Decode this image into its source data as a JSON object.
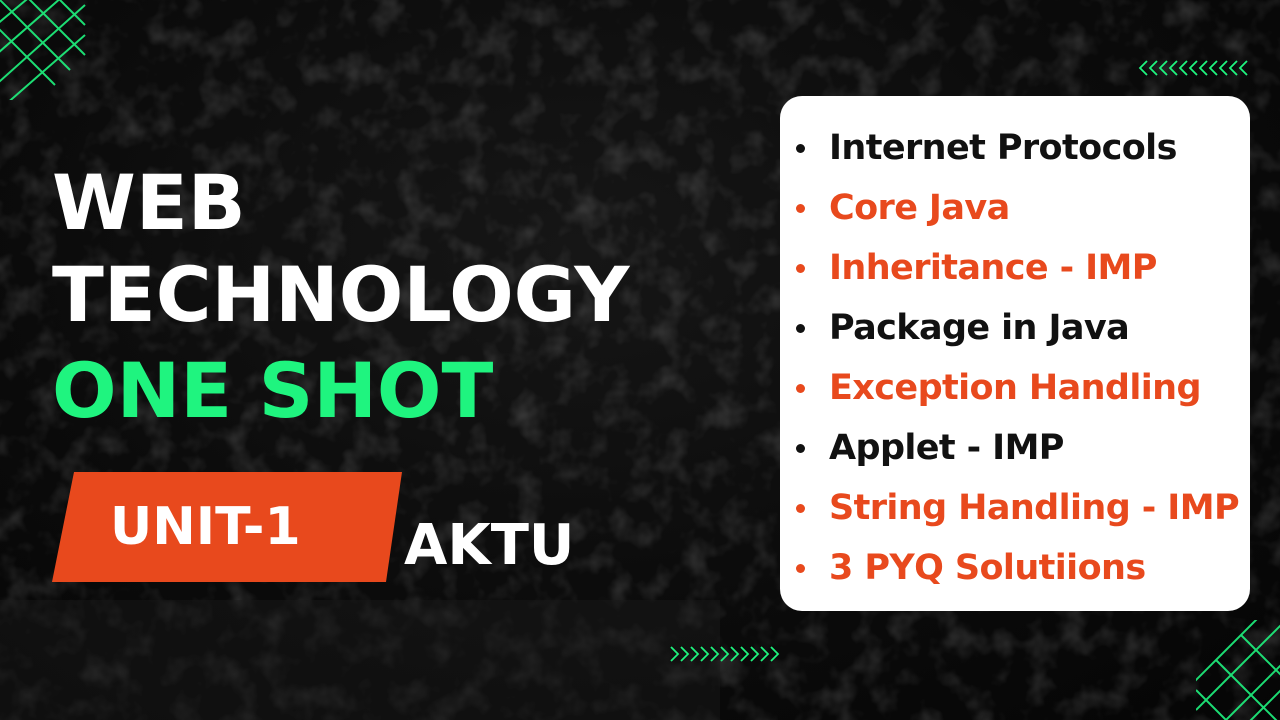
{
  "title": {
    "line1": "WEB",
    "line2": "TECHNOLOGY",
    "line3": "ONE SHOT"
  },
  "badge": {
    "unit_label": "UNIT-1",
    "aktu_label": "AKTU"
  },
  "topics": [
    {
      "label": "Internet Protocols",
      "color": "#111111"
    },
    {
      "label": "Core Java",
      "color": "#e8491d"
    },
    {
      "label": "Inheritance - IMP",
      "color": "#e8491d"
    },
    {
      "label": "Package in Java",
      "color": "#111111"
    },
    {
      "label": "Exception Handling",
      "color": "#e8491d"
    },
    {
      "label": "Applet - IMP",
      "color": "#111111"
    },
    {
      "label": "String Handling - IMP",
      "color": "#e8491d"
    },
    {
      "label": "3 PYQ Solutiions",
      "color": "#e8491d"
    }
  ],
  "colors": {
    "accent_green": "#1ff47f",
    "accent_orange": "#e8491d",
    "background": "#0a0a0a",
    "card_background": "#ffffff",
    "text_white": "#ffffff",
    "text_dark": "#111111"
  },
  "icons": {
    "grid_top_left": "grid-pattern-icon",
    "grid_bottom_right": "grid-pattern-icon",
    "chevrons_top_right": "chevron-row-icon",
    "chevrons_bottom": "chevron-row-icon"
  }
}
